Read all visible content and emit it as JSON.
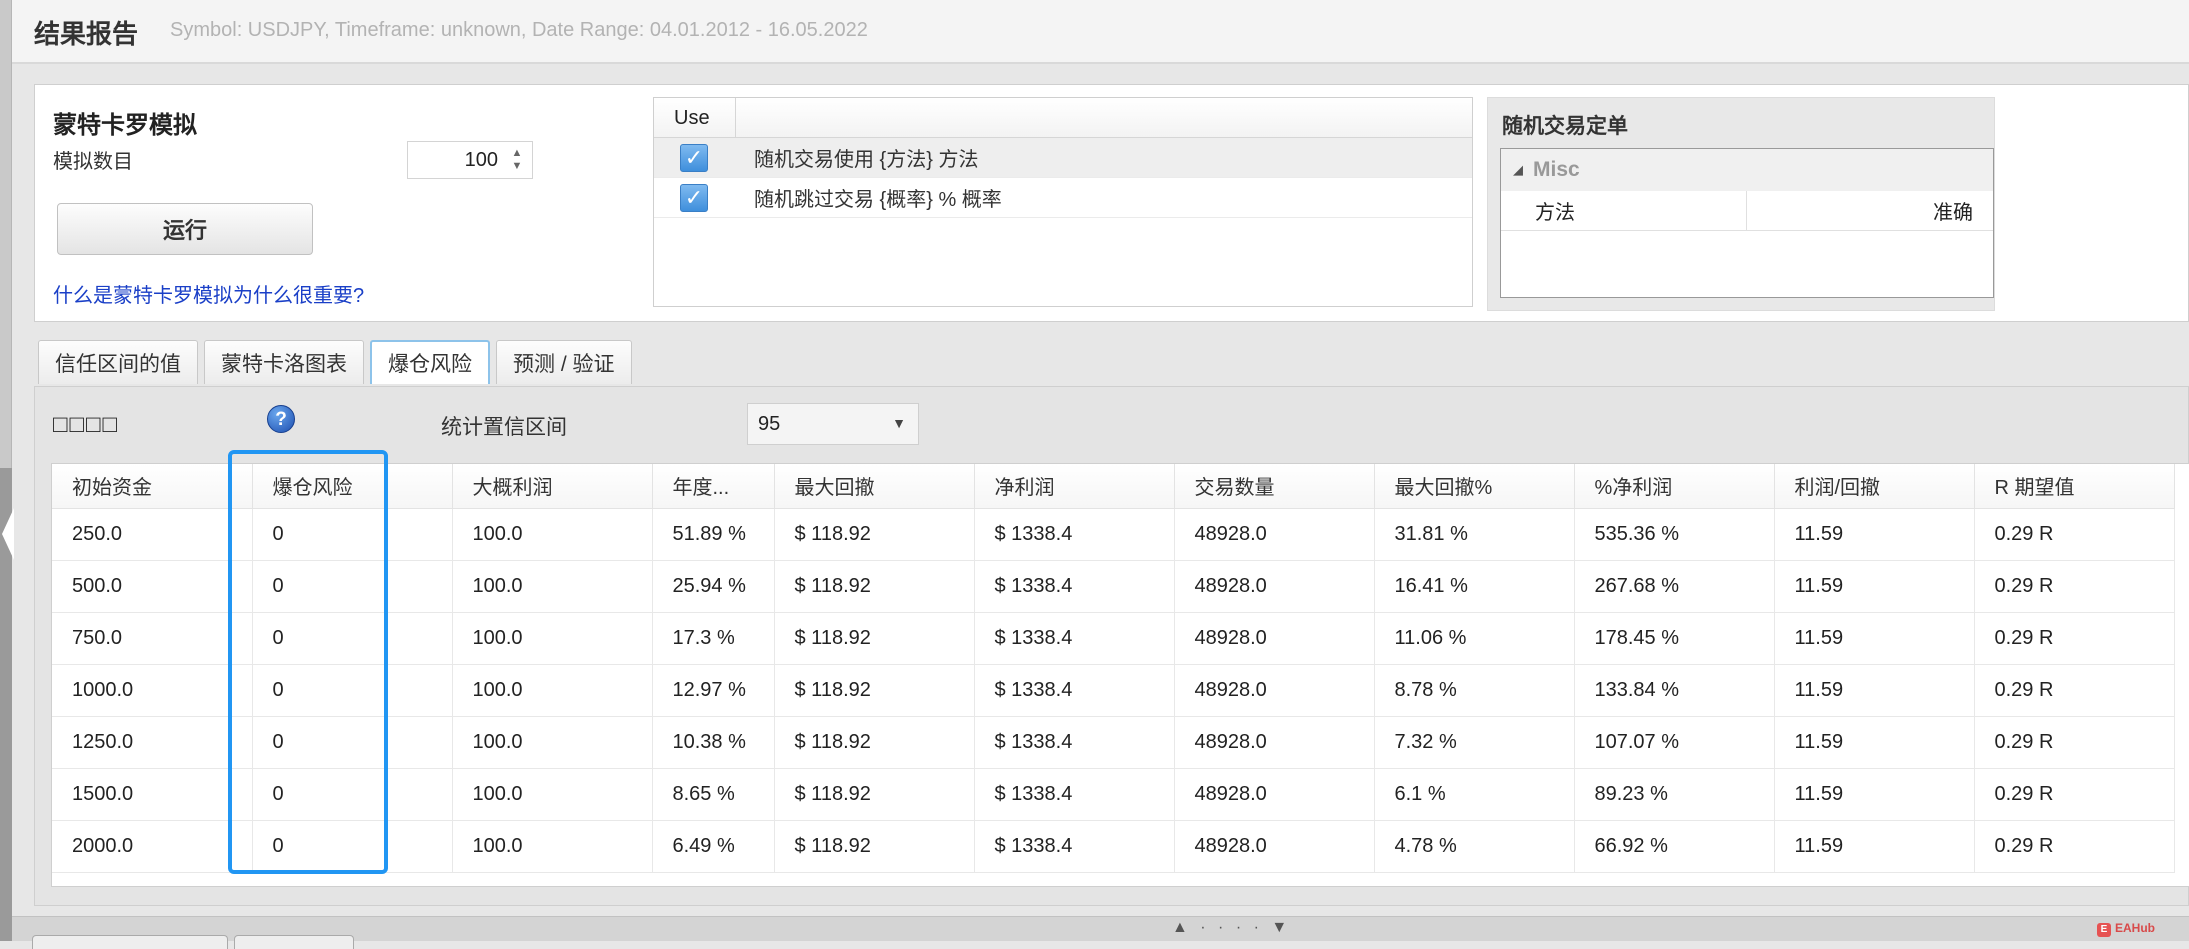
{
  "header": {
    "title": "结果报告",
    "subtitle": "Symbol: USDJPY, Timeframe: unknown, Date Range: 04.01.2012 - 16.05.2022"
  },
  "simulation": {
    "title": "蒙特卡罗模拟",
    "count_label": "模拟数目",
    "count_value": "100",
    "run_label": "运行",
    "help_link": "什么是蒙特卡罗模拟为什么很重要?"
  },
  "options": {
    "use_header": "Use",
    "rows": [
      {
        "label": "随机交易使用 {方法} 方法",
        "checked": true
      },
      {
        "label": "随机跳过交易 {概率} % 概率",
        "checked": true
      }
    ]
  },
  "random_order": {
    "title": "随机交易定单",
    "category": "Misc",
    "key": "方法",
    "value": "准确"
  },
  "tabs": [
    {
      "label": "信任区间的值",
      "active": false
    },
    {
      "label": "蒙特卡洛图表",
      "active": false
    },
    {
      "label": "爆仓风险",
      "active": true
    },
    {
      "label": "预测 / 验证",
      "active": false
    }
  ],
  "panel": {
    "squares_label": "□□□□",
    "help_icon": "question-icon",
    "confidence_label": "统计置信区间",
    "confidence_value": "95"
  },
  "table": {
    "columns": [
      "初始资金",
      "爆仓风险",
      "大概利润",
      "年度...",
      "最大回撤",
      "净利润",
      "交易数量",
      "最大回撤%",
      "%净利润",
      "利润/回撤",
      "R 期望值"
    ],
    "rows": [
      [
        "250.0",
        "0",
        "100.0",
        "51.89 %",
        "$ 118.92",
        "$ 1338.4",
        "48928.0",
        "31.81 %",
        "535.36 %",
        "11.59",
        "0.29 R"
      ],
      [
        "500.0",
        "0",
        "100.0",
        "25.94 %",
        "$ 118.92",
        "$ 1338.4",
        "48928.0",
        "16.41 %",
        "267.68 %",
        "11.59",
        "0.29 R"
      ],
      [
        "750.0",
        "0",
        "100.0",
        "17.3 %",
        "$ 118.92",
        "$ 1338.4",
        "48928.0",
        "11.06 %",
        "178.45 %",
        "11.59",
        "0.29 R"
      ],
      [
        "1000.0",
        "0",
        "100.0",
        "12.97 %",
        "$ 118.92",
        "$ 1338.4",
        "48928.0",
        "8.78 %",
        "133.84 %",
        "11.59",
        "0.29 R"
      ],
      [
        "1250.0",
        "0",
        "100.0",
        "10.38 %",
        "$ 118.92",
        "$ 1338.4",
        "48928.0",
        "7.32 %",
        "107.07 %",
        "11.59",
        "0.29 R"
      ],
      [
        "1500.0",
        "0",
        "100.0",
        "8.65 %",
        "$ 118.92",
        "$ 1338.4",
        "48928.0",
        "6.1 %",
        "89.23 %",
        "11.59",
        "0.29 R"
      ],
      [
        "2000.0",
        "0",
        "100.0",
        "6.49 %",
        "$ 118.92",
        "$ 1338.4",
        "48928.0",
        "4.78 %",
        "66.92 %",
        "11.59",
        "0.29 R"
      ]
    ]
  },
  "highlight_color": "#2196f3",
  "watermark": "EAHub"
}
